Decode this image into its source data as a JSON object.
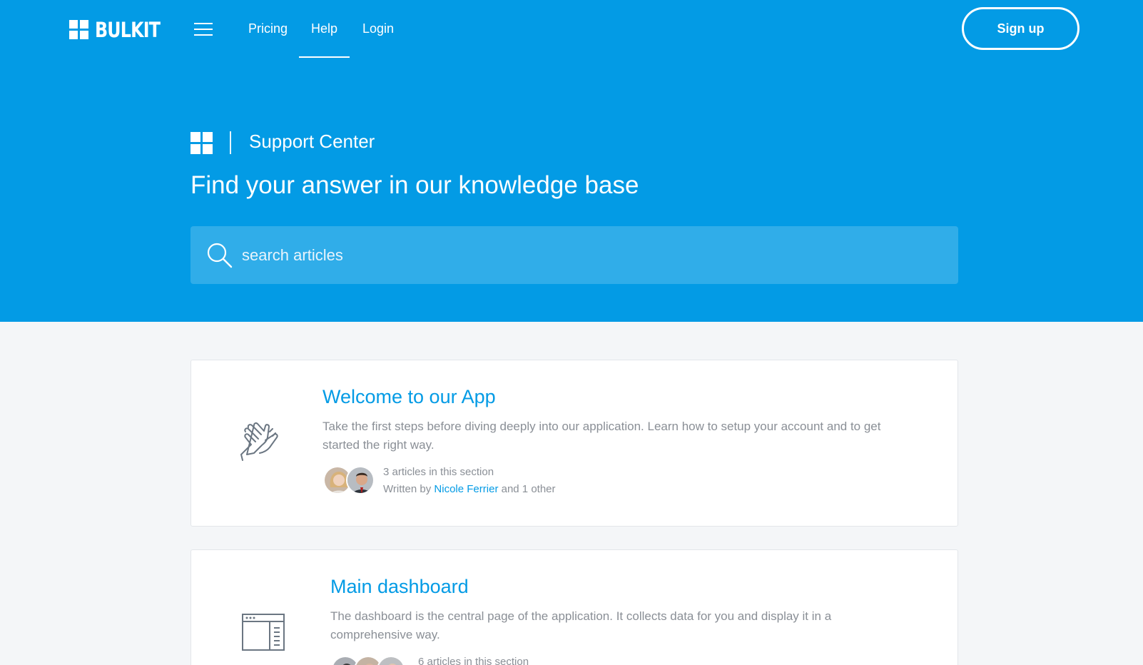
{
  "brand": {
    "name": "BULKIT"
  },
  "nav": {
    "items": [
      {
        "label": "Pricing"
      },
      {
        "label": "Help",
        "active": true
      },
      {
        "label": "Login"
      }
    ],
    "signup_label": "Sign up"
  },
  "hero": {
    "section_title": "Support Center",
    "heading": "Find your answer in our knowledge base",
    "search": {
      "placeholder": "search articles",
      "value": ""
    }
  },
  "sections": [
    {
      "title": "Welcome to our App",
      "icon": "clapping-hands-icon",
      "description": "Take the first steps before diving deeply into our application. Learn how to setup your account and to get started the right way.",
      "article_count": "3 articles in this section",
      "written_by_prefix": "Written by",
      "author": "Nicole Ferrier",
      "written_by_suffix": "and 1 other"
    },
    {
      "title": "Main dashboard",
      "icon": "dashboard-window-icon",
      "description": "The dashboard is the central page of the application. It collects data for you and display it in a comprehensive way.",
      "article_count": "6 articles in this section"
    }
  ],
  "colors": {
    "primary": "#039be5",
    "background": "#f4f6f8",
    "text_muted": "#8a8f96",
    "card_border": "#e3e6ea"
  }
}
